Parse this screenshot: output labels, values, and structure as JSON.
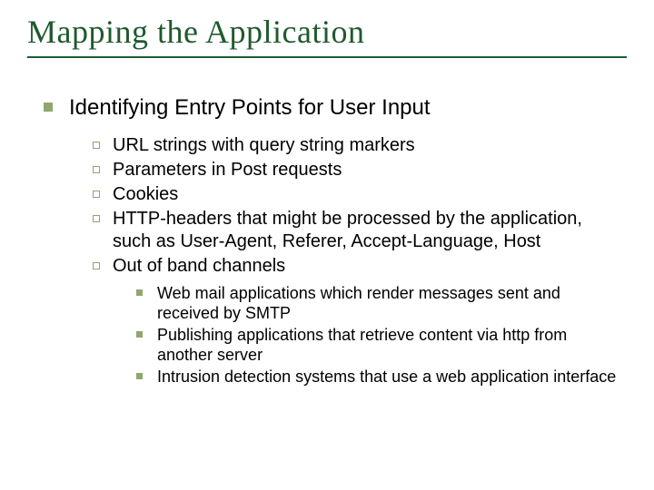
{
  "title": "Mapping the Application",
  "level1": "Identifying Entry Points for User Input",
  "level2": [
    "URL strings with query string markers",
    "Parameters in Post requests",
    "Cookies",
    "HTTP-headers that might be processed by the application, such as User-Agent, Referer, Accept-Language, Host",
    "Out of band channels"
  ],
  "level3": [
    "Web mail applications which render messages sent and received by SMTP",
    "Publishing applications that retrieve content via http from another server",
    "Intrusion detection systems that use a web application interface"
  ]
}
